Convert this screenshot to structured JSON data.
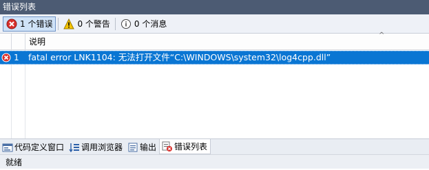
{
  "window": {
    "title": "错误列表"
  },
  "toolbar": {
    "errors_label": "1 个错误",
    "warnings_label": "0 个警告",
    "messages_label": "0 个消息"
  },
  "grid": {
    "columns": {
      "description": "说明"
    },
    "rows": [
      {
        "icon": "error-icon",
        "index": "1",
        "description": "fatal error LNK1104: 无法打开文件“C:\\WINDOWS\\system32\\log4cpp.dll”"
      }
    ]
  },
  "tabs": [
    {
      "label": "代码定义窗口",
      "icon": "code-definition-icon"
    },
    {
      "label": "调用浏览器",
      "icon": "call-browser-icon"
    },
    {
      "label": "输出",
      "icon": "output-icon"
    },
    {
      "label": "错误列表",
      "icon": "error-list-icon",
      "active": true
    }
  ],
  "status": {
    "text": "就绪"
  },
  "colors": {
    "title_bg": "#4c5b73",
    "selection": "#0a76d3",
    "error_red": "#d9302c",
    "warning_yellow": "#f5c400"
  }
}
